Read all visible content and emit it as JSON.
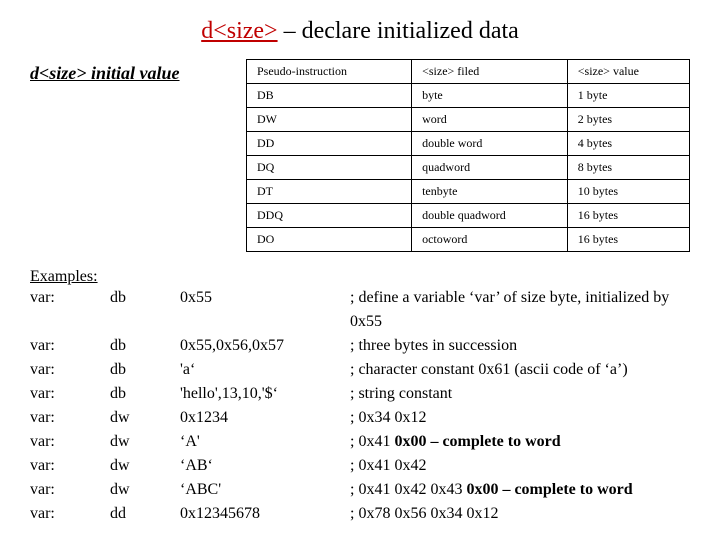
{
  "title_red": "d<size>",
  "title_rest": " – declare initialized data",
  "syntax_text": "d<size> initial value",
  "table": {
    "header": [
      "Pseudo-instruction",
      "<size> filed",
      "<size> value"
    ],
    "rows": [
      [
        "DB",
        "byte",
        "1 byte"
      ],
      [
        "DW",
        "word",
        "2 bytes"
      ],
      [
        "DD",
        "double word",
        "4 bytes"
      ],
      [
        "DQ",
        "quadword",
        "8 bytes"
      ],
      [
        "DT",
        "tenbyte",
        "10 bytes"
      ],
      [
        "DDQ",
        "double quadword",
        "16 bytes"
      ],
      [
        "DO",
        "octoword",
        "16 bytes"
      ]
    ]
  },
  "examples_label": "Examples:",
  "examples": [
    {
      "var": "var:",
      "op": "db",
      "val": "0x55",
      "comment": "; define a variable ‘var’ of size byte, initialized by 0x55"
    },
    {
      "var": "var:",
      "op": "db",
      "val": "0x55,0x56,0x57",
      "comment": "; three bytes in succession"
    },
    {
      "var": "var:",
      "op": "db",
      "val": "'a‘",
      "comment": "; character constant 0x61 (ascii code of ‘a’)"
    },
    {
      "var": "var:",
      "op": "db",
      "val": "'hello',13,10,'$‘",
      "comment": "; string constant"
    },
    {
      "var": "var:",
      "op": "dw",
      "val": "0x1234",
      "comment": "; 0x34 0x12"
    },
    {
      "var": "var:",
      "op": "dw",
      "val": "‘A'",
      "comment": "; 0x41 ",
      "bold": "0x00 – complete to word"
    },
    {
      "var": "var:",
      "op": "dw",
      "val": "‘AB‘",
      "comment": "; 0x41 0x42"
    },
    {
      "var": "var:",
      "op": "dw",
      "val": "‘ABC'",
      "comment": "; 0x41 0x42 0x43 ",
      "bold": "0x00 – complete to word"
    },
    {
      "var": "var:",
      "op": "dd",
      "val": "0x12345678",
      "comment": "; 0x78 0x56 0x34 0x12"
    }
  ]
}
